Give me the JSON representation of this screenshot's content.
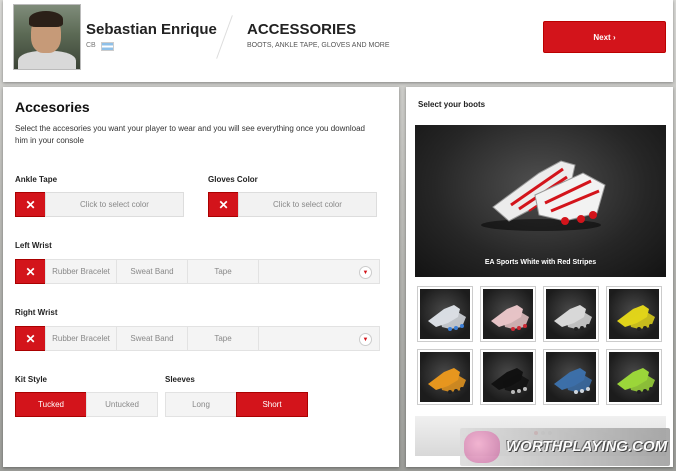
{
  "header": {
    "player_name": "Sebastian Enrique",
    "player_position": "CB",
    "page_title": "ACCESSORIES",
    "page_subtitle": "BOOTS, ANKLE TAPE, GLOVES AND MORE",
    "next_label": "Next ›"
  },
  "accessories": {
    "title": "Accesories",
    "description": "Select the accesories you want your player to wear and you will see everything once you download him in your console",
    "ankle_tape": {
      "label": "Ankle Tape",
      "clear": "✕",
      "color_prompt": "Click to select color"
    },
    "gloves_color": {
      "label": "Gloves Color",
      "clear": "✕",
      "color_prompt": "Click to select color"
    },
    "left_wrist": {
      "label": "Left Wrist",
      "clear": "✕",
      "options": [
        "Rubber Bracelet",
        "Sweat Band",
        "Tape"
      ],
      "dropdown_icon": "chevron-down-icon"
    },
    "right_wrist": {
      "label": "Right Wrist",
      "clear": "✕",
      "options": [
        "Rubber Bracelet",
        "Sweat Band",
        "Tape"
      ],
      "dropdown_icon": "chevron-down-icon"
    },
    "kit_style": {
      "label": "Kit Style",
      "options": [
        "Tucked",
        "Untucked"
      ],
      "selected": "Tucked"
    },
    "sleeves": {
      "label": "Sleeves",
      "options": [
        "Long",
        "Short"
      ],
      "selected": "Short"
    }
  },
  "boots": {
    "label": "Select your boots",
    "selected_name": "EA Sports White with Red Stripes",
    "thumbnails": [
      {
        "color": "#d9dde3",
        "accent": "#3d7fd6"
      },
      {
        "color": "#e6c3c6",
        "accent": "#cc2a35"
      },
      {
        "color": "#d8d8d8",
        "accent": "#222222"
      },
      {
        "color": "#e0d31a",
        "accent": "#222222"
      },
      {
        "color": "#e6961e",
        "accent": "#222222"
      },
      {
        "color": "#111111",
        "accent": "#bbbbbb"
      },
      {
        "color": "#3c6fa8",
        "accent": "#cfd6dd"
      },
      {
        "color": "#9bd63a",
        "accent": "#222222"
      }
    ]
  },
  "watermark": {
    "text": "WORTHPLAYING.COM"
  },
  "colors": {
    "accent_red": "#d3141b"
  }
}
